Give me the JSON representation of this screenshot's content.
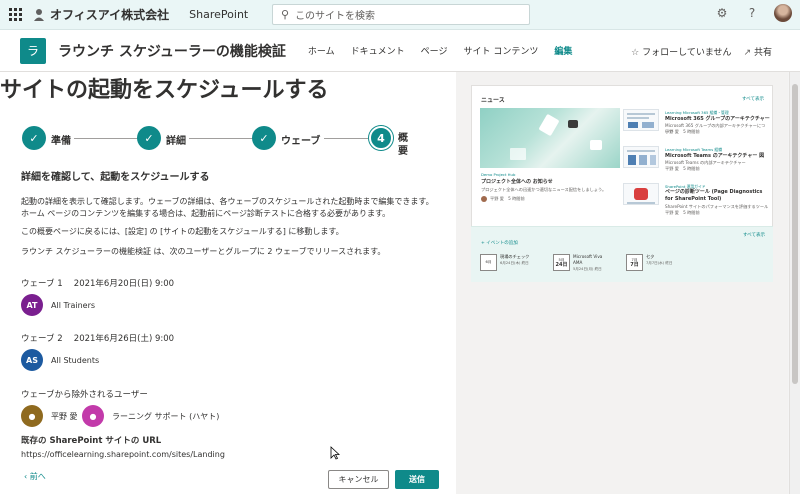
{
  "suite": {
    "org_name": "オフィスアイ株式会社",
    "app_name": "SharePoint",
    "search_placeholder": "このサイトを検索"
  },
  "site": {
    "logo_letter": "ラ",
    "title": "ラウンチ スケジューラーの機能検証",
    "nav": [
      "ホーム",
      "ドキュメント",
      "ページ",
      "サイト コンテンツ",
      "編集"
    ],
    "follow": "フォローしていません",
    "share": "共有"
  },
  "panel": {
    "heading": "サイトの起動をスケジュールする",
    "steps": [
      {
        "label": "準備",
        "status": "done",
        "glyph": "✓"
      },
      {
        "label": "詳細",
        "status": "done",
        "glyph": "✓"
      },
      {
        "label": "ウェーブ",
        "status": "done",
        "glyph": "✓"
      },
      {
        "label": "概要",
        "status": "current",
        "glyph": "4"
      }
    ],
    "subheading": "詳細を確認して、起動をスケジュールする",
    "para1": "起動の詳細を表示して確認します。ウェーブの詳細は、各ウェーブのスケジュールされた起動時まで編集できます。ホーム ページのコンテンツを編集する場合は、起動前にページ診断テストに合格する必要があります。",
    "para2": "この概要ページに戻るには、[設定] の [サイトの起動をスケジュールする] に移動します。",
    "para3": "ラウンチ スケジューラーの機能検証 は、次のユーザーとグループに 2 ウェーブでリリースされます。",
    "wave1": {
      "title": "ウェーブ 1　 2021年6月20日(日) 9:00",
      "initials": "AT",
      "group": "All Trainers"
    },
    "wave2": {
      "title": "ウェーブ 2　 2021年6月26日(土) 9:00",
      "initials": "AS",
      "group": "All Students"
    },
    "excluded_title": "ウェーブから除外されるユーザー",
    "excluded_users": [
      "平野 愛",
      "ラーニング サポート (ハヤト)"
    ],
    "url_label": "既存の SharePoint サイトの URL",
    "url": "https://officelearning.sharepoint.com/sites/Landing",
    "prev": "前へ",
    "cancel": "キャンセル",
    "send": "送信"
  },
  "preview": {
    "news_title": "ニュース",
    "see_all": "すべて表示",
    "hero_tag": "Demo Project Hub",
    "hero_title": "プロジェクト全体への お知らせ",
    "hero_desc": "プロジェクト全体への迅速かつ適切なニュース配信をしましょう。",
    "hero_author": "平野 愛　5 時間前",
    "items": [
      {
        "tag": "Learning Microsoft 365 組織・管理",
        "title": "Microsoft 365 グループのアーキテクチャー",
        "desc": "Microsoft 365 グループの内部アーキテクチャーについて",
        "author": "平野 愛　5 時間前"
      },
      {
        "tag": "Learning Microsoft Teams 組織",
        "title": "Microsoft Teams のアーキテクチャー 図",
        "desc": "Microsoft Teams の内部アーキテクチャー",
        "author": "平野 愛　5 時間前"
      },
      {
        "tag": "SharePoint 運用ガイド",
        "title": "ページの診断ツール (Page Diagnostics for SharePoint Tool)",
        "desc": "SharePoint サイトのパフォーマンスを評価するツール",
        "author": "平野 愛　5 時間前"
      }
    ],
    "events_label": "+ イベントの追加",
    "events": [
      {
        "m": "6月",
        "d": "",
        "title": "現場のチェック",
        "sub": "6月24日(木) 終日"
      },
      {
        "m": "5月",
        "d": "24日",
        "title": "Microsoft Viva AMA",
        "sub": "5月24日(月) 終日"
      },
      {
        "m": "7月",
        "d": "7日",
        "title": "七夕",
        "sub": "7月7日(水) 終日"
      }
    ]
  }
}
